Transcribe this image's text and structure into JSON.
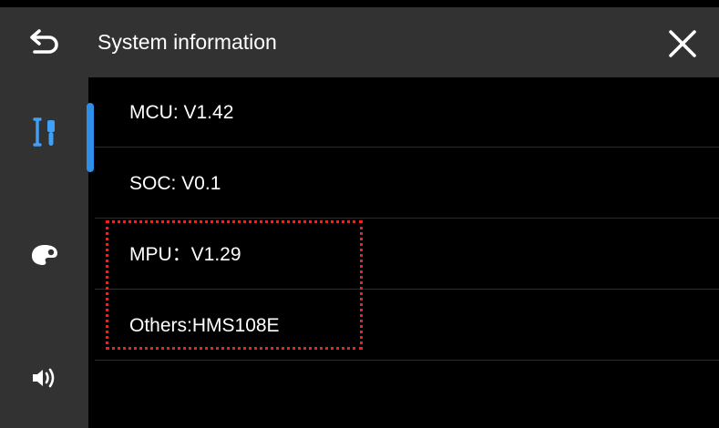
{
  "header": {
    "title": "System information",
    "back_icon": "back-arrow-icon",
    "close_icon": "close-icon"
  },
  "sidebar": {
    "items": [
      {
        "icon": "tools-icon",
        "selected": true
      },
      {
        "icon": "palette-icon",
        "selected": false
      },
      {
        "icon": "speaker-icon",
        "selected": false
      }
    ]
  },
  "info_rows": [
    {
      "text": "MCU: V1.42"
    },
    {
      "text": "SOC: V0.1"
    },
    {
      "text": "MPU：V1.29"
    },
    {
      "text": "Others:HMS108E"
    }
  ],
  "colors": {
    "header_bg": "#323232",
    "sidebar_bg": "#323232",
    "content_bg": "#000000",
    "accent": "#2d8fe8",
    "highlight_border": "#ff1a1a",
    "text": "#ffffff"
  }
}
